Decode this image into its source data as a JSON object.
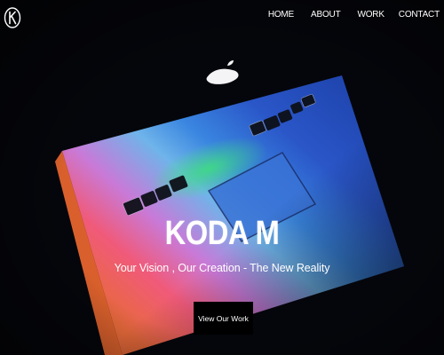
{
  "brand": {
    "logo_icon": "k-monogram-icon"
  },
  "nav": {
    "items": [
      {
        "label": "HOME"
      },
      {
        "label": "ABOUT"
      },
      {
        "label": "WORK"
      },
      {
        "label": "CONTACT"
      }
    ]
  },
  "hero": {
    "title": "KODA M",
    "tagline": "Your Vision , Our Creation - The New Reality",
    "cta_label": "View Our Work",
    "background_image": "laptop-keyboard-gradient-photo"
  },
  "colors": {
    "background": "#05060b",
    "text": "#ffffff",
    "button": "#000000"
  }
}
